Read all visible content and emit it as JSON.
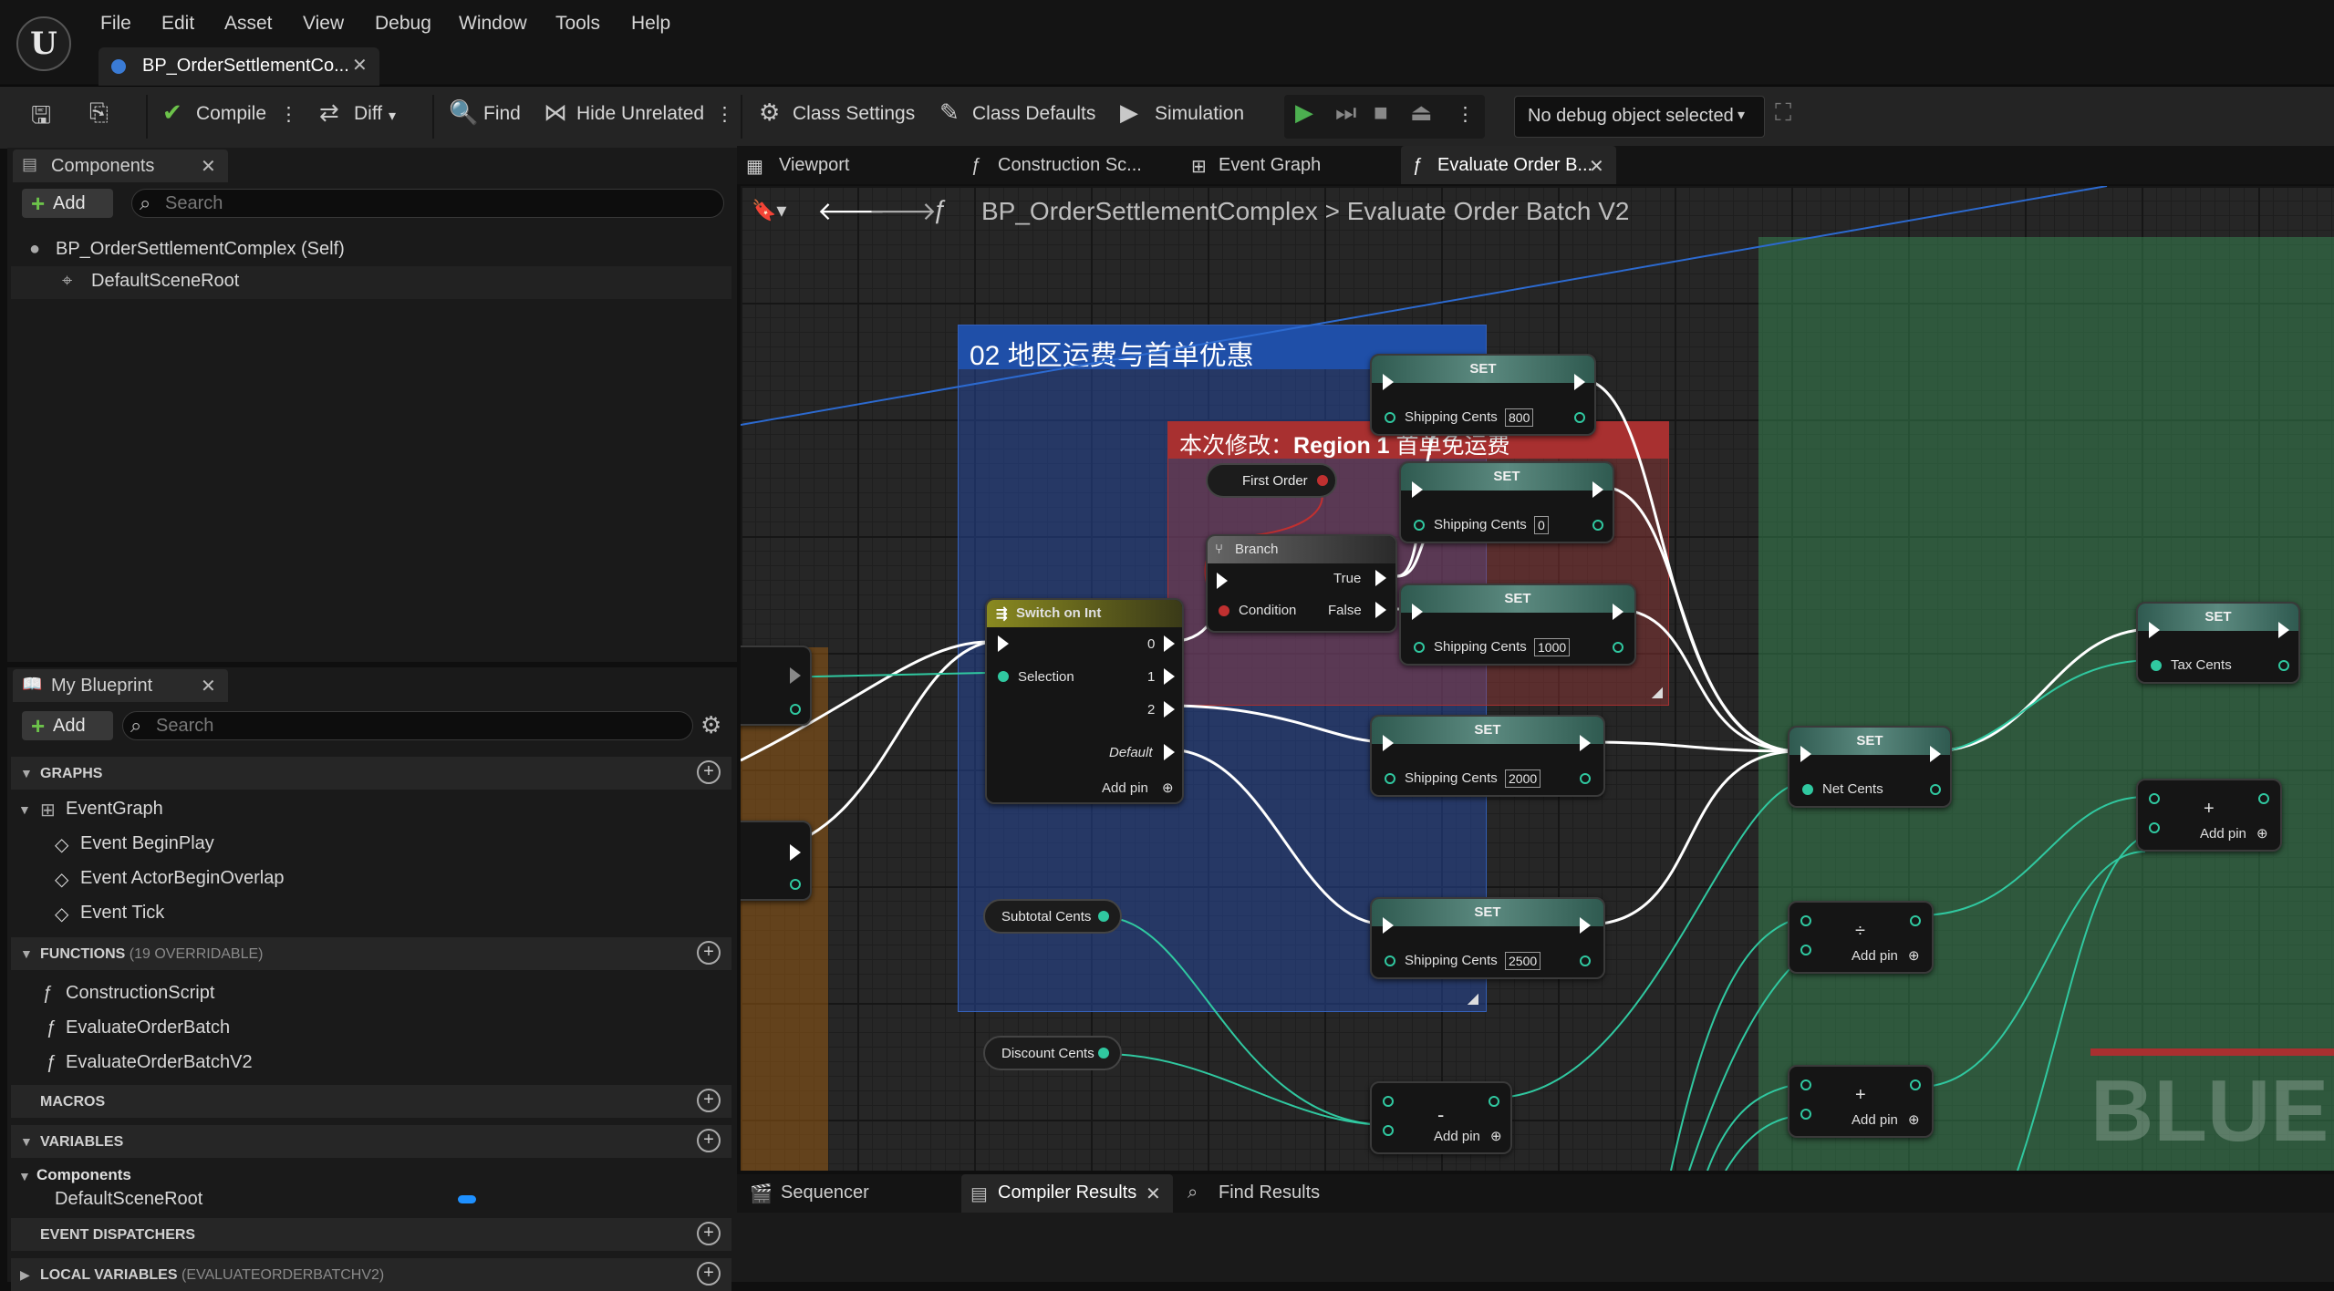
{
  "menu": [
    "File",
    "Edit",
    "Asset",
    "View",
    "Debug",
    "Window",
    "Tools",
    "Help"
  ],
  "logo_text": "U",
  "document_tab": "BP_OrderSettlementCo...",
  "toolbar": {
    "compile": "Compile",
    "diff": "Diff",
    "find": "Find",
    "hide_unrelated": "Hide Unrelated",
    "class_settings": "Class Settings",
    "class_defaults": "Class Defaults",
    "simulation": "Simulation",
    "debug_object": "No debug object selected"
  },
  "components": {
    "title": "Components",
    "add": "Add",
    "search_placeholder": "Search",
    "items": [
      "BP_OrderSettlementComplex (Self)",
      "DefaultSceneRoot"
    ]
  },
  "my_blueprint": {
    "title": "My Blueprint",
    "add": "Add",
    "search_placeholder": "Search",
    "graphs_label": "GRAPHS",
    "graph_root": "EventGraph",
    "events": [
      "Event BeginPlay",
      "Event ActorBeginOverlap",
      "Event Tick"
    ],
    "functions_label": "FUNCTIONS",
    "functions_sub": "(19 OVERRIDABLE)",
    "functions": [
      "ConstructionScript",
      "EvaluateOrderBatch",
      "EvaluateOrderBatchV2"
    ],
    "macros_label": "MACROS",
    "variables_label": "VARIABLES",
    "var_category": "Components",
    "var_item": "DefaultSceneRoot",
    "dispatchers_label": "EVENT DISPATCHERS",
    "locals_label": "LOCAL VARIABLES",
    "locals_sub": "(EVALUATEORDERBATCHV2)"
  },
  "graph_tabs": [
    "Viewport",
    "Construction Sc...",
    "Event Graph",
    "Evaluate Order B..."
  ],
  "breadcrumb": {
    "root": "BP_OrderSettlementComplex",
    "sep": ">",
    "current": "Evaluate Order Batch V2"
  },
  "comments": {
    "region": "02 地区运费与首单优惠",
    "change_prefix": "本次修改：",
    "change_bold": "Region 1",
    "change_suffix": " 首单免运费"
  },
  "nodes": {
    "set_title": "SET",
    "shipping": "Shipping Cents",
    "ship_values": [
      "800",
      "0",
      "1000",
      "2000",
      "2500"
    ],
    "first_order": "First Order",
    "branch": "Branch",
    "true": "True",
    "false": "False",
    "condition": "Condition",
    "switch": "Switch on Int",
    "selection": "Selection",
    "cases": [
      "0",
      "1",
      "2"
    ],
    "default": "Default",
    "add_pin": "Add pin",
    "subtotal": "Subtotal Cents",
    "discount": "Discount Cents",
    "net": "Net Cents",
    "tax": "Tax Cents",
    "op_minus": "-",
    "op_div": "÷",
    "op_plus": "+",
    "watermark": "BLUEPR"
  },
  "bottom_tabs": [
    "Sequencer",
    "Compiler Results",
    "Find Results"
  ],
  "colors": {
    "accent_blue": "#3a7bd5",
    "comment_blue": "#1f4fa8",
    "comment_red": "#a83030",
    "play_green": "#4caf50",
    "float_pin": "#30c8a0"
  }
}
